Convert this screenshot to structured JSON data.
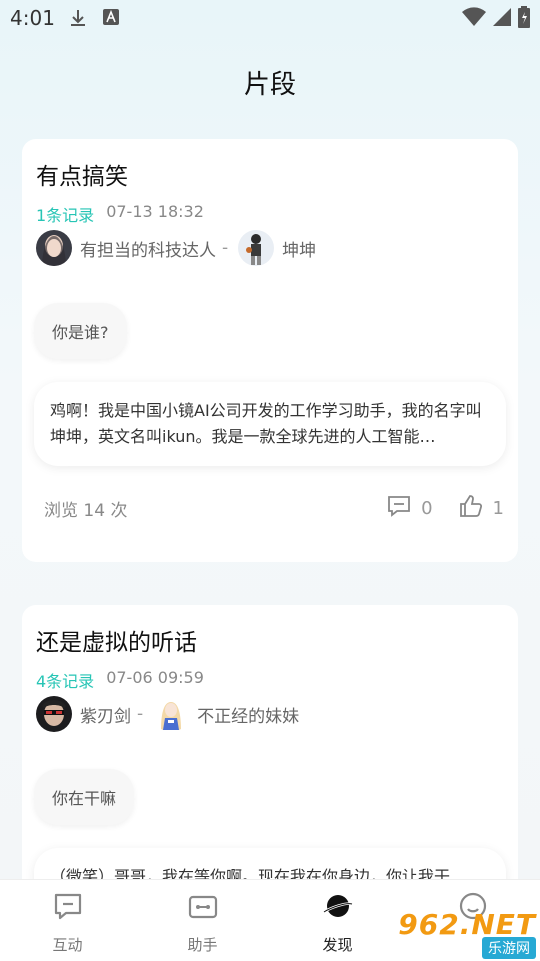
{
  "status_bar": {
    "time": "4:01"
  },
  "header": {
    "title": "片段"
  },
  "cards": [
    {
      "title": "有点搞笑",
      "records": "1条记录",
      "date": "07-13 18:32",
      "user1": "有担当的科技达人",
      "separator": "-",
      "user2": "坤坤",
      "question": "你是谁?",
      "answer": "鸡啊！我是中国小镜AI公司开发的工作学习助手，我的名字叫坤坤，英文名叫ikun。我是一款全球先进的人工智能…",
      "views": "浏览 14 次",
      "comments": "0",
      "likes": "1"
    },
    {
      "title": "还是虚拟的听话",
      "records": "4条记录",
      "date": "07-06 09:59",
      "user1": "紫刃剑",
      "separator": "-",
      "user2": "不正经的妹妹",
      "question": "你在干嘛",
      "answer": "（微笑）哥哥，我在等你啊。现在我在你身边，你让我干"
    }
  ],
  "bottom_nav": [
    {
      "label": "互动",
      "icon": "chat-icon"
    },
    {
      "label": "助手",
      "icon": "robot-icon"
    },
    {
      "label": "发现",
      "icon": "planet-icon",
      "active": true
    },
    {
      "label": "",
      "icon": "profile-icon"
    }
  ],
  "watermark": {
    "top": "962.NET",
    "bottom": "乐游网"
  },
  "colors": {
    "accent": "#27c5b5"
  }
}
